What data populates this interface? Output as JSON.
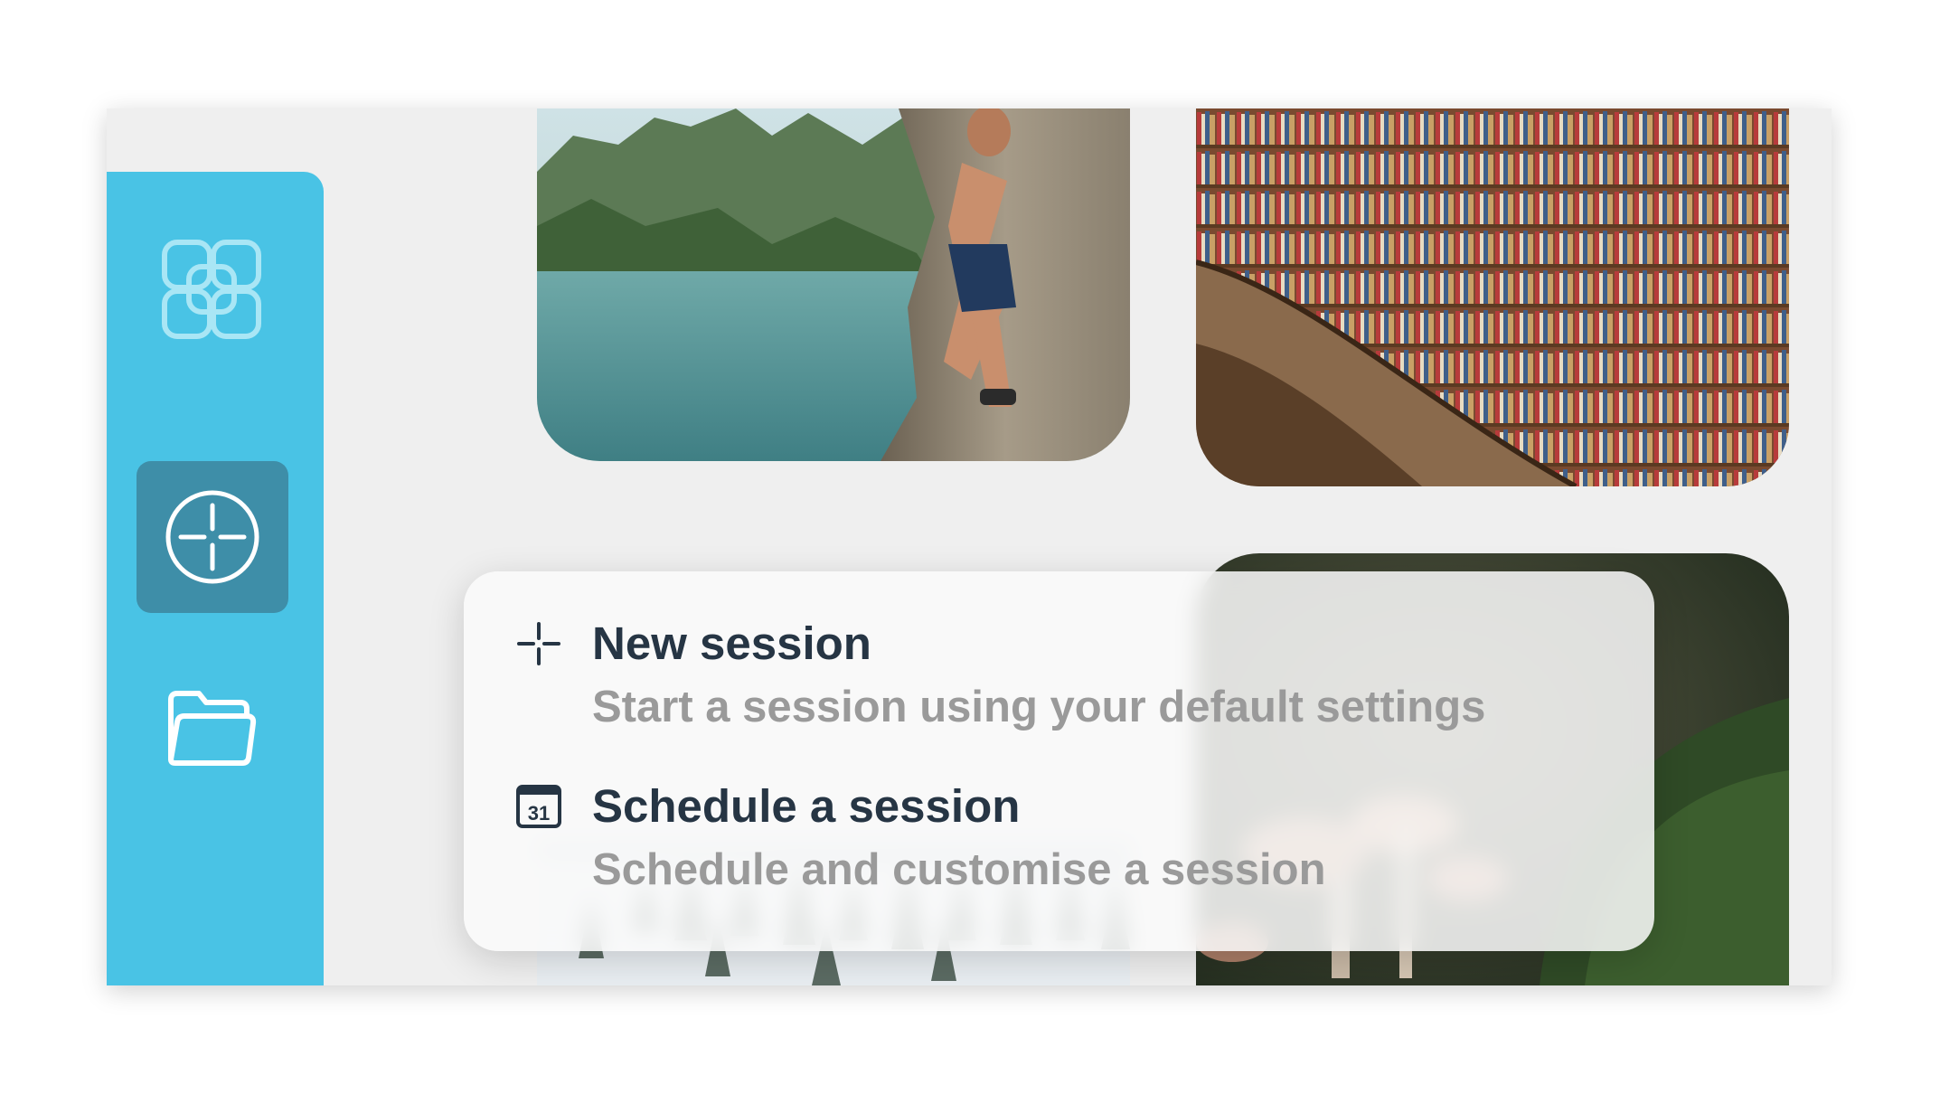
{
  "sidebar": {
    "logo_icon": "clover-grid-logo-icon",
    "items": [
      {
        "icon": "new-session-compass-icon",
        "active": true
      },
      {
        "icon": "folder-icon",
        "active": false
      }
    ],
    "accent": "#49c3e5",
    "active_bg": "#3e8ea8"
  },
  "gallery": {
    "tiles": [
      "rock-climber-photo",
      "library-bookshelves-photo",
      "mushrooms-moss-photo",
      "snowy-forest-photo"
    ]
  },
  "menu": {
    "items": [
      {
        "icon": "sparkle-icon",
        "title": "New session",
        "description": "Start a session using your default settings"
      },
      {
        "icon": "calendar-icon",
        "calendar_day": "31",
        "title": "Schedule a session",
        "description": "Schedule and customise a session"
      }
    ]
  }
}
